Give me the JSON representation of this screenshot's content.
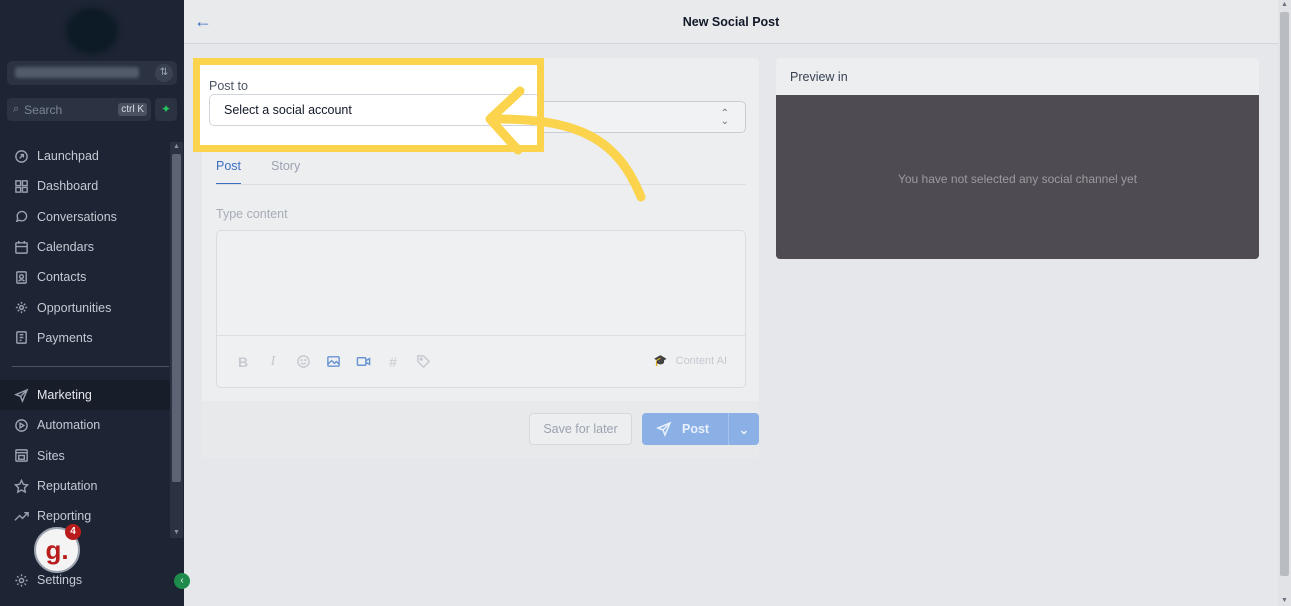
{
  "sidebar": {
    "search": {
      "placeholder": "Search",
      "shortcut": "ctrl K"
    },
    "items": [
      {
        "label": "Launchpad",
        "icon": "launchpad-icon"
      },
      {
        "label": "Dashboard",
        "icon": "dashboard-icon"
      },
      {
        "label": "Conversations",
        "icon": "chat-icon"
      },
      {
        "label": "Calendars",
        "icon": "calendar-icon"
      },
      {
        "label": "Contacts",
        "icon": "contacts-icon"
      },
      {
        "label": "Opportunities",
        "icon": "opportunities-icon"
      },
      {
        "label": "Payments",
        "icon": "payments-icon"
      }
    ],
    "items2": [
      {
        "label": "Marketing",
        "icon": "send-icon",
        "active": true
      },
      {
        "label": "Automation",
        "icon": "automation-icon"
      },
      {
        "label": "Sites",
        "icon": "sites-icon"
      },
      {
        "label": "Reputation",
        "icon": "star-icon"
      },
      {
        "label": "Reporting",
        "icon": "trend-icon"
      }
    ],
    "settings_label": "Settings",
    "avatar_letter": "g.",
    "notification_count": "4"
  },
  "header": {
    "title": "New Social Post"
  },
  "form": {
    "post_to_label": "Post to",
    "select_placeholder": "Select a social account",
    "tabs": [
      {
        "label": "Post",
        "active": true
      },
      {
        "label": "Story",
        "active": false
      }
    ],
    "content_placeholder": "Type content",
    "content_ai_label": "Content AI",
    "save_later_label": "Save for later",
    "post_label": "Post"
  },
  "preview": {
    "title": "Preview in",
    "empty_message": "You have not selected any social channel yet"
  },
  "colors": {
    "highlight": "#fcd34d",
    "accent": "#3b6fc2",
    "sidebar_bg": "#1d2433"
  }
}
